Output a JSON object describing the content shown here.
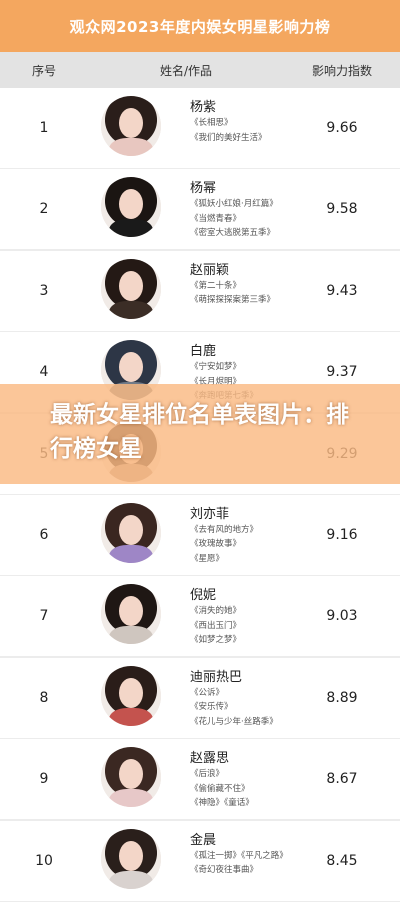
{
  "header": {
    "title": "观众网2023年度内娱女明星影响力榜"
  },
  "columns": {
    "rank": "序号",
    "name": "姓名/作品",
    "score": "影响力指数"
  },
  "rows": [
    {
      "rank": "1",
      "name": "杨紫",
      "works": [
        "《长相思》",
        "《我们的美好生活》"
      ],
      "score": "9.66",
      "hair": "#2a1e1a",
      "outfit": "#e8c7c0"
    },
    {
      "rank": "2",
      "name": "杨幂",
      "works": [
        "《狐妖小红娘·月红篇》",
        "《当燃青春》",
        "《密室大逃脱第五季》"
      ],
      "score": "9.58",
      "hair": "#1b1512",
      "outfit": "#1a1a1a"
    },
    {
      "rank": "3",
      "name": "赵丽颖",
      "works": [
        "《第二十条》",
        "《萌探探探案第三季》"
      ],
      "score": "9.43",
      "hair": "#241915",
      "outfit": "#3b2d26"
    },
    {
      "rank": "4",
      "name": "白鹿",
      "works": [
        "《宁安如梦》",
        "《长月烬明》",
        "《奔跑吧第七季》"
      ],
      "score": "9.37",
      "hair": "#2d3646",
      "outfit": "#6f7a88"
    },
    {
      "rank": "5",
      "name": "",
      "works": [],
      "score": "9.29",
      "hair": "#3a2a24",
      "outfit": "#b79a8b"
    },
    {
      "rank": "6",
      "name": "刘亦菲",
      "works": [
        "《去有风的地方》",
        "《玫瑰故事》",
        "《星愿》"
      ],
      "score": "9.16",
      "hair": "#3a2620",
      "outfit": "#9e86c6"
    },
    {
      "rank": "7",
      "name": "倪妮",
      "works": [
        "《消失的她》",
        "《西出玉门》",
        "《如梦之梦》"
      ],
      "score": "9.03",
      "hair": "#1f1714",
      "outfit": "#cfc6bf"
    },
    {
      "rank": "8",
      "name": "迪丽热巴",
      "works": [
        "《公诉》",
        "《安乐传》",
        "《花儿与少年·丝路季》"
      ],
      "score": "8.89",
      "hair": "#2a1d19",
      "outfit": "#c4534e"
    },
    {
      "rank": "9",
      "name": "赵露思",
      "works": [
        "《后浪》",
        "《偷偷藏不住》",
        "《神隐》《童话》"
      ],
      "score": "8.67",
      "hair": "#3b2822",
      "outfit": "#e7c8c8"
    },
    {
      "rank": "10",
      "name": "金晨",
      "works": [
        "《孤注一掷》《平凡之路》",
        "《奇幻夜往事曲》"
      ],
      "score": "8.45",
      "hair": "#2a1f1b",
      "outfit": "#d9d2cf"
    }
  ],
  "overlay": {
    "title": "最新女星排位名单表图片：排行榜女星"
  }
}
